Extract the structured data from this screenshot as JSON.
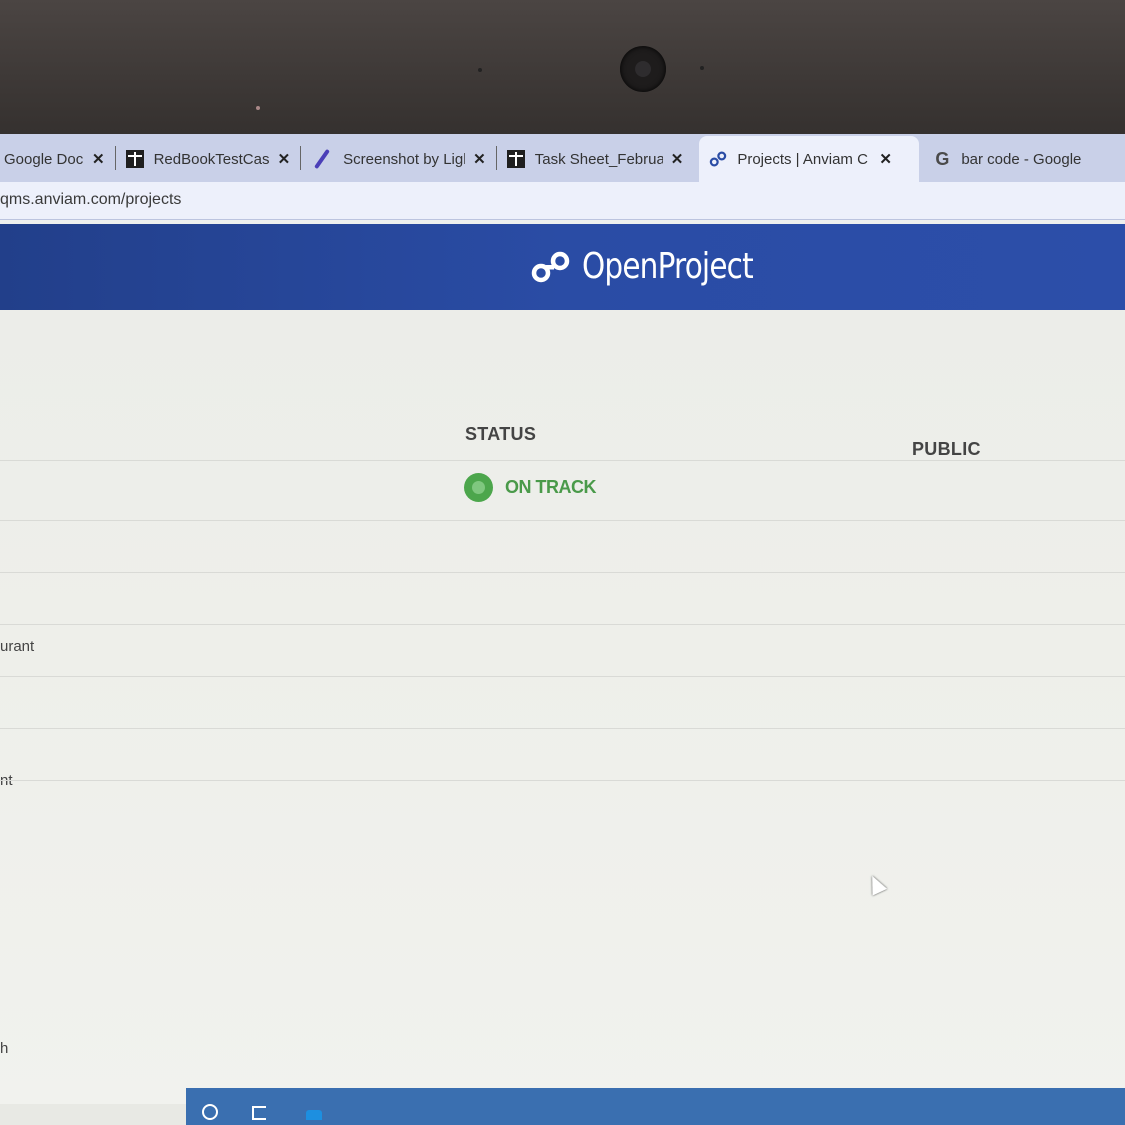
{
  "browser": {
    "tabs": [
      {
        "title": "Google Doc",
        "favicon": "docs-icon",
        "active": false
      },
      {
        "title": "RedBookTestCases",
        "favicon": "sheets-icon",
        "active": false
      },
      {
        "title": "Screenshot by Ligh",
        "favicon": "lightshot-pen-icon",
        "active": false
      },
      {
        "title": "Task Sheet_Februa",
        "favicon": "sheets-icon",
        "active": false
      },
      {
        "title": "Projects | Anviam C",
        "favicon": "openproject-icon",
        "active": true
      },
      {
        "title": "bar code - Google",
        "favicon": "google-g-icon",
        "active": false
      }
    ],
    "close_glyph": "✕",
    "url": "qms.anviam.com/projects"
  },
  "header": {
    "logo_text": "OpenProject",
    "brand_color": "#2a4ca5"
  },
  "table": {
    "status_header": "STATUS",
    "public_header": "PUBLIC",
    "status_value": "ON TRACK",
    "status_color": "#4ca64c"
  },
  "side_fragments": [
    "urant",
    "nt"
  ],
  "bottom_fragment": "h"
}
